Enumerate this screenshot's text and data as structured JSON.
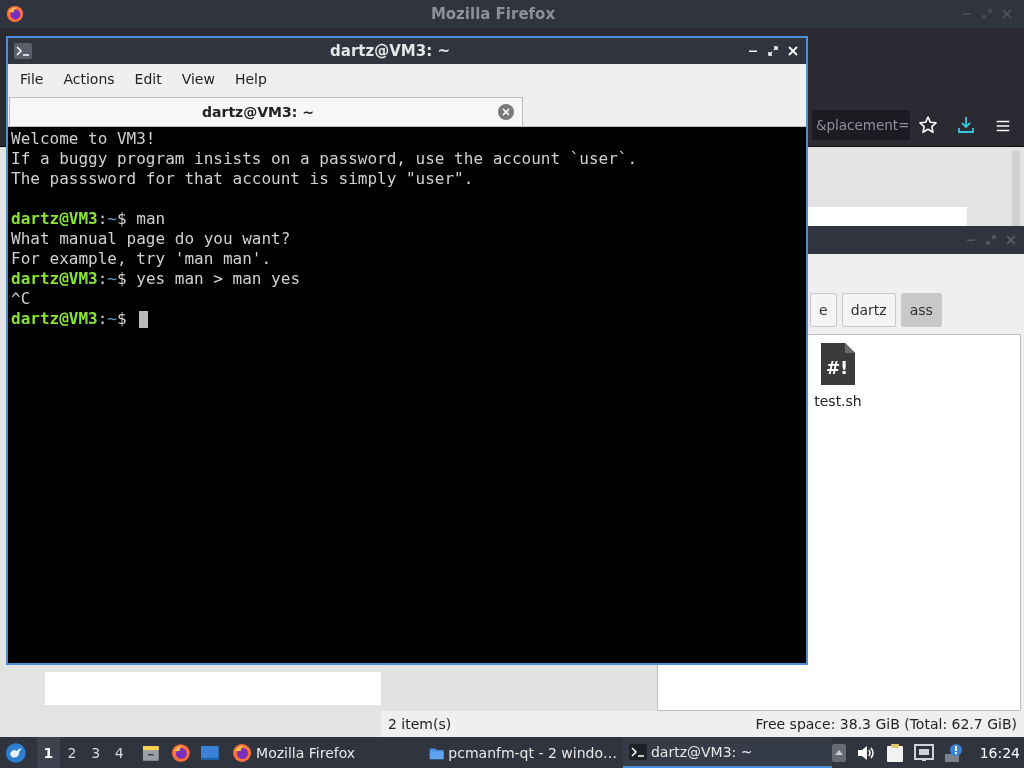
{
  "firefox": {
    "title": "Mozilla Firefox",
    "url_fragment": "&placement="
  },
  "file_manager": {
    "path": [
      {
        "label": "e",
        "selected": false
      },
      {
        "label": "dartz",
        "selected": false
      },
      {
        "label": "ass",
        "selected": true
      }
    ],
    "files": [
      {
        "name": "test.sh",
        "badge": "#!"
      }
    ],
    "status_left": "2 item(s)",
    "status_right": "Free space: 38.3 GiB (Total: 62.7 GiB)"
  },
  "terminal": {
    "title": "dartz@VM3: ~",
    "menu": [
      "File",
      "Actions",
      "Edit",
      "View",
      "Help"
    ],
    "tabs": [
      {
        "label": "dartz@VM3: ~",
        "selected": true
      }
    ],
    "lines": [
      {
        "kind": "text",
        "text": "Welcome to VM3!"
      },
      {
        "kind": "text",
        "text": "If a buggy program insists on a password, use the account `user`."
      },
      {
        "kind": "text",
        "text": "The passsword for that account is simply \"user\"."
      },
      {
        "kind": "blank"
      },
      {
        "kind": "prompt",
        "user": "dartz@VM3",
        "separator": ":",
        "path": "~",
        "symbol": "$",
        "command": "man",
        "cursor": false
      },
      {
        "kind": "text",
        "text": "What manual page do you want?"
      },
      {
        "kind": "text",
        "text": "For example, try 'man man'."
      },
      {
        "kind": "prompt",
        "user": "dartz@VM3",
        "separator": ":",
        "path": "~",
        "symbol": "$",
        "command": "yes man > man yes",
        "cursor": false
      },
      {
        "kind": "text",
        "text": "^C"
      },
      {
        "kind": "prompt",
        "user": "dartz@VM3",
        "separator": ":",
        "path": "~",
        "symbol": "$",
        "cursor": true
      }
    ]
  },
  "taskbar": {
    "desktops": [
      {
        "label": "1",
        "selected": true
      },
      {
        "label": "2",
        "selected": false
      },
      {
        "label": "3",
        "selected": false
      },
      {
        "label": "4",
        "selected": false
      }
    ],
    "tasks": [
      {
        "label": "Mozilla Firefox",
        "kind": "firefox",
        "selected": false
      },
      {
        "label": "pcmanfm-qt - 2 windo…",
        "kind": "folder",
        "selected": false
      },
      {
        "label": "dartz@VM3: ~",
        "kind": "terminal",
        "selected": true
      }
    ],
    "clock": "16:24"
  }
}
